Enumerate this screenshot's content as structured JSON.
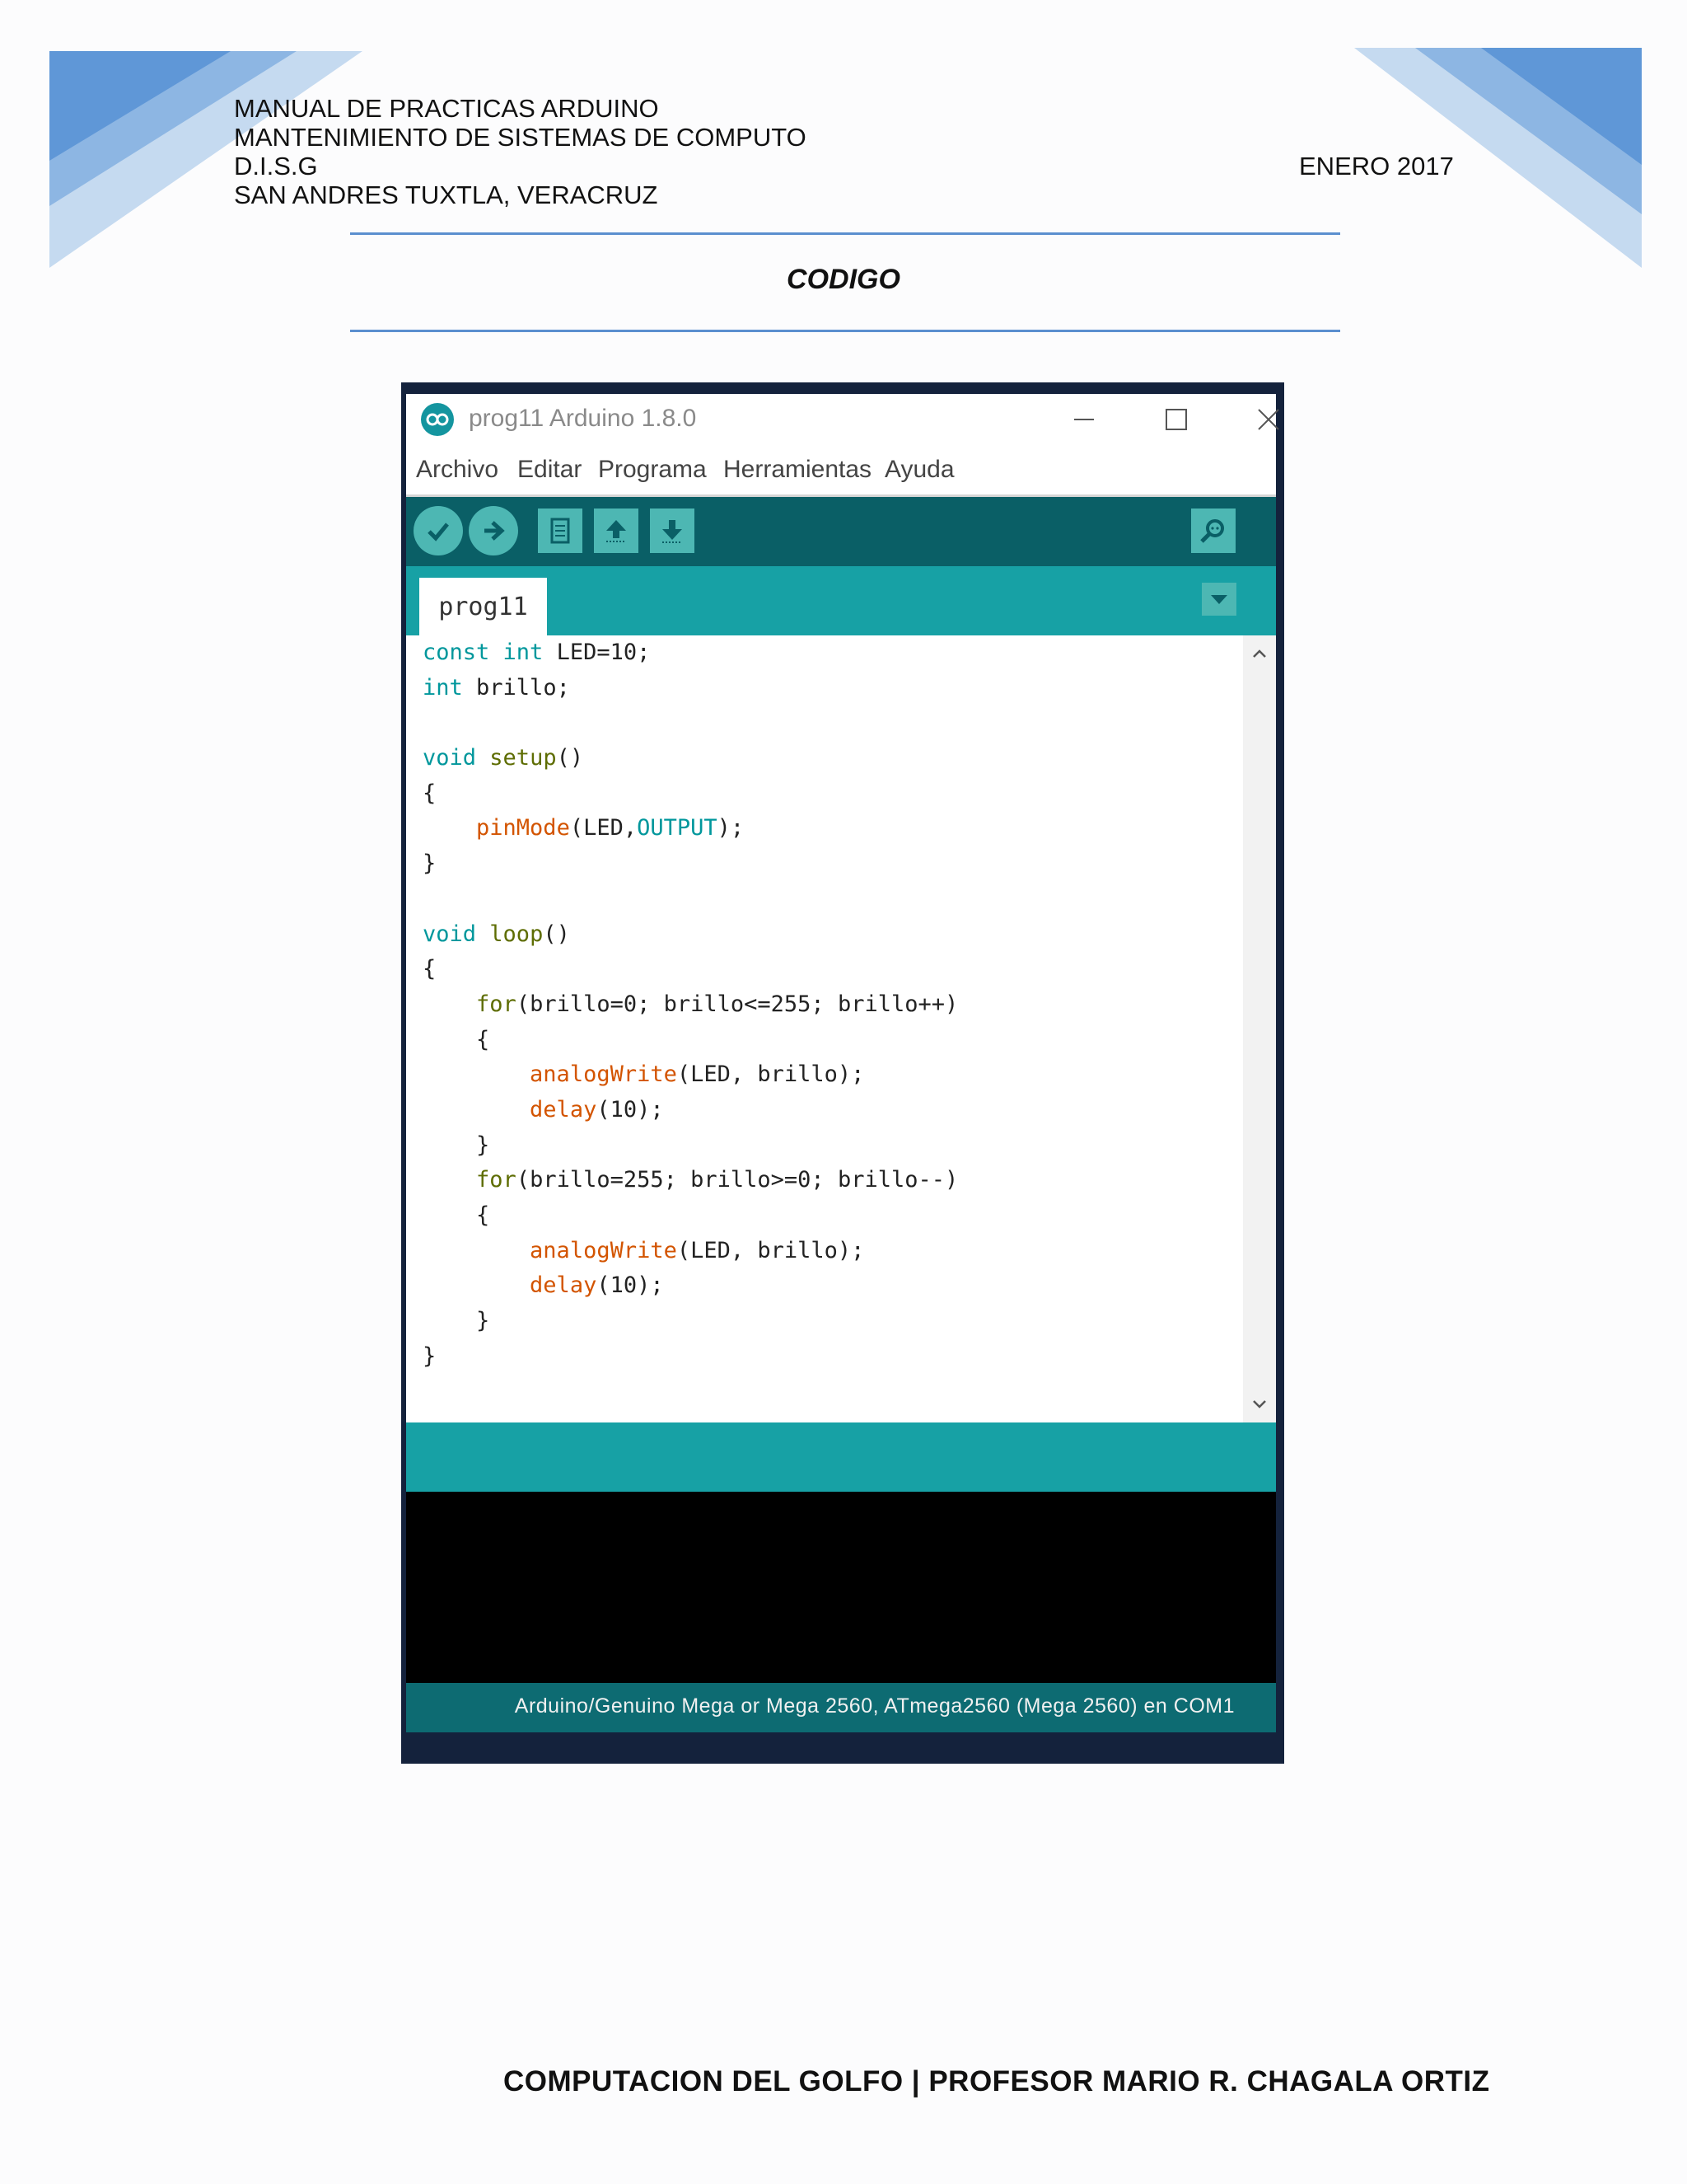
{
  "header": {
    "lines": [
      "MANUAL DE PRACTICAS ARDUINO",
      "MANTENIMIENTO  DE SISTEMAS  DE COMPUTO",
      "D.I.S.G",
      "SAN ANDRES TUXTLA,  VERACRUZ"
    ],
    "date": "ENERO 2017"
  },
  "section_title": "CODIGO",
  "window": {
    "title": "prog11 Arduino 1.8.0",
    "menu": [
      "Archivo",
      "Editar",
      "Programa",
      "Herramientas",
      "Ayuda"
    ],
    "toolbar_icons": [
      "verify-icon",
      "upload-icon",
      "new-icon",
      "open-icon",
      "save-icon",
      "serial-monitor-icon"
    ],
    "tab": "prog11",
    "code": [
      [
        {
          "t": "const",
          "c": "kw"
        },
        {
          "t": " "
        },
        {
          "t": "int",
          "c": "kw"
        },
        {
          "t": " LED=10;"
        }
      ],
      [
        {
          "t": "int",
          "c": "kw"
        },
        {
          "t": " brillo;"
        }
      ],
      [],
      [
        {
          "t": "void",
          "c": "kw"
        },
        {
          "t": " "
        },
        {
          "t": "setup",
          "c": "fn"
        },
        {
          "t": "()"
        }
      ],
      [
        {
          "t": "{"
        }
      ],
      [
        {
          "t": "    "
        },
        {
          "t": "pinMode",
          "c": "ard"
        },
        {
          "t": "(LED,"
        },
        {
          "t": "OUTPUT",
          "c": "cst"
        },
        {
          "t": ");"
        }
      ],
      [
        {
          "t": "}"
        }
      ],
      [],
      [
        {
          "t": "void",
          "c": "kw"
        },
        {
          "t": " "
        },
        {
          "t": "loop",
          "c": "fn"
        },
        {
          "t": "()"
        }
      ],
      [
        {
          "t": "{"
        }
      ],
      [
        {
          "t": "    "
        },
        {
          "t": "for",
          "c": "fn"
        },
        {
          "t": "(brillo=0; brillo<=255; brillo++)"
        }
      ],
      [
        {
          "t": "    {"
        }
      ],
      [
        {
          "t": "        "
        },
        {
          "t": "analogWrite",
          "c": "ard"
        },
        {
          "t": "(LED, brillo);"
        }
      ],
      [
        {
          "t": "        "
        },
        {
          "t": "delay",
          "c": "ard"
        },
        {
          "t": "(10);"
        }
      ],
      [
        {
          "t": "    }"
        }
      ],
      [
        {
          "t": "    "
        },
        {
          "t": "for",
          "c": "fn"
        },
        {
          "t": "(brillo=255; brillo>=0; brillo--)"
        }
      ],
      [
        {
          "t": "    {"
        }
      ],
      [
        {
          "t": "        "
        },
        {
          "t": "analogWrite",
          "c": "ard"
        },
        {
          "t": "(LED, brillo);"
        }
      ],
      [
        {
          "t": "        "
        },
        {
          "t": "delay",
          "c": "ard"
        },
        {
          "t": "(10);"
        }
      ],
      [
        {
          "t": "    }"
        }
      ],
      [
        {
          "t": "}"
        }
      ]
    ],
    "status": "Arduino/Genuino Mega or Mega 2560, ATmega2560 (Mega 2560) en COM1"
  },
  "footer": "COMPUTACION  DEL GOLFO | PROFESOR  MARIO  R.  CHAGALA  ORTIZ",
  "colors": {
    "keyword": "#00979c",
    "function": "#5e6d03",
    "arduino_fn": "#d35400",
    "toolbar": "#0a5f66",
    "tabbar": "#17a1a5",
    "accent_blue": "#5b8fcf"
  }
}
